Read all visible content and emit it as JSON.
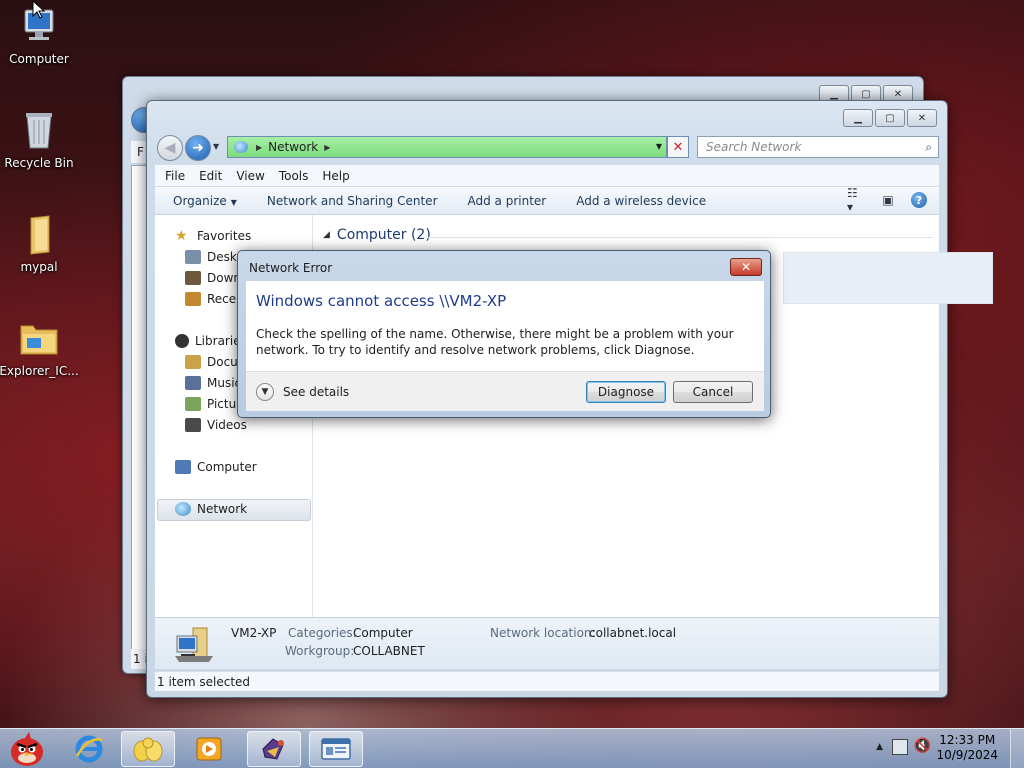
{
  "desktop": {
    "icons": [
      {
        "label": "Computer",
        "icon": "computer-icon"
      },
      {
        "label": "Recycle Bin",
        "icon": "recycle-bin-icon"
      },
      {
        "label": "mypal",
        "icon": "folder-icon"
      },
      {
        "label": "Explorer_IC...",
        "icon": "folder-icon"
      }
    ]
  },
  "back_window": {
    "menu_first_letter": "F",
    "status_fragment": "1 it"
  },
  "window": {
    "address": {
      "crumb": "Network"
    },
    "search_placeholder": "Search Network",
    "menu": [
      "File",
      "Edit",
      "View",
      "Tools",
      "Help"
    ],
    "toolbar": {
      "organize": "Organize",
      "network_sharing": "Network and Sharing Center",
      "add_printer": "Add a printer",
      "add_wireless": "Add a wireless device"
    },
    "nav": {
      "favorites": "Favorites",
      "desktop": "Deskto",
      "downloads": "Down",
      "recent": "Recen",
      "libraries": "Librarie",
      "documents": "Docu",
      "music": "Music",
      "pictures": "Pictur",
      "videos": "Videos",
      "computer": "Computer",
      "network": "Network"
    },
    "group_header": "Computer (2)",
    "details": {
      "name": "VM2-XP",
      "categories_label": "Categories:",
      "categories_value": "Computer",
      "workgroup_label": "Workgroup:",
      "workgroup_value": "COLLABNET",
      "netloc_label": "Network location:",
      "netloc_value": "collabnet.local"
    },
    "status": "1 item selected"
  },
  "dialog": {
    "title": "Network Error",
    "heading": "Windows cannot access \\\\VM2-XP",
    "message": "Check the spelling of the name. Otherwise, there might be a problem with your network. To try to identify and resolve network problems, click Diagnose.",
    "see_details": "See details",
    "diagnose": "Diagnose",
    "cancel": "Cancel"
  },
  "taskbar": {
    "time": "12:33 PM",
    "date": "10/9/2024"
  },
  "colors": {
    "address_bar": "#7ddc7d",
    "dialog_heading": "#1e3b8e",
    "close_button": "#c7392a"
  }
}
